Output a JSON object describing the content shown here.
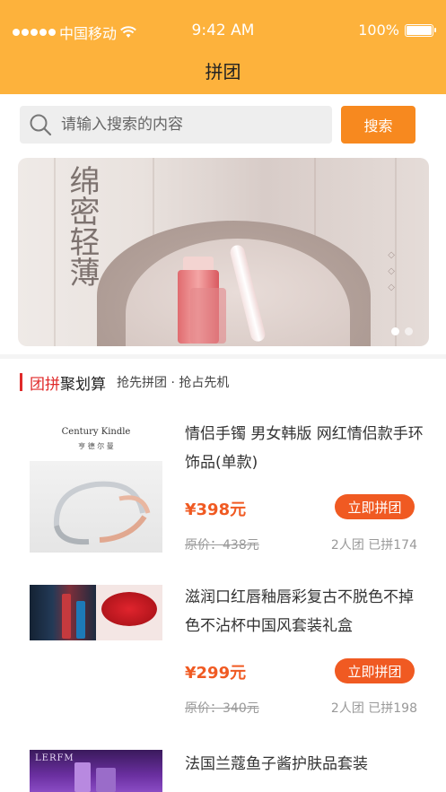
{
  "status": {
    "carrier": "中国移动",
    "time": "9:42 AM",
    "battery": "100%"
  },
  "header": {
    "title": "拼团"
  },
  "search": {
    "placeholder": "请输入搜索的内容",
    "button": "搜索"
  },
  "banner": {
    "vertical_title": "绵密轻薄",
    "page_count": 2,
    "active_page": 1
  },
  "section": {
    "title_red": "团拼",
    "title_black": "聚划算",
    "subtitle": "抢先拼团 · 抢占先机"
  },
  "products": [
    {
      "name": "情侣手镯 男女韩版 网红情侣款手环饰品(单款)",
      "price": "¥398元",
      "buy": "立即拼团",
      "original": "原价：438元",
      "meta": "2人团 已拼174",
      "brand": "Century Kindle",
      "brand_sub": "亨 德 尔 曼"
    },
    {
      "name": "滋润口红唇釉唇彩复古不脱色不掉色不沾杯中国风套装礼盒",
      "price": "¥299元",
      "buy": "立即拼团",
      "original": "原价：340元",
      "meta": "2人团 已拼198"
    },
    {
      "name": "法国兰蔻鱼子酱护肤品套装",
      "brand": "LERFM"
    }
  ]
}
